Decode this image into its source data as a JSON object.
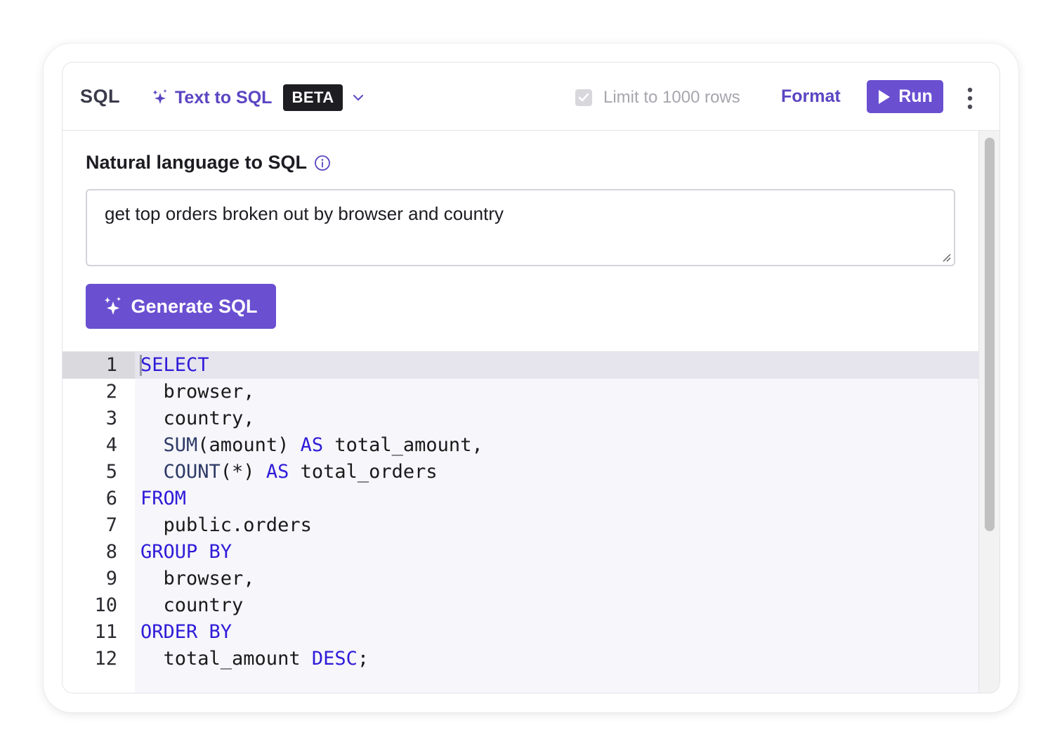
{
  "toolbar": {
    "sql_label": "SQL",
    "text_to_sql_label": "Text to SQL",
    "beta_label": "BETA",
    "limit_label": "Limit to 1000 rows",
    "limit_checked": true,
    "format_label": "Format",
    "run_label": "Run"
  },
  "nl": {
    "label": "Natural language to SQL",
    "query_value": "get top orders broken out by browser and country",
    "generate_label": "Generate SQL"
  },
  "editor": {
    "active_line": 1,
    "lines": [
      {
        "n": "1",
        "tokens": [
          {
            "t": "SELECT",
            "c": "kw"
          }
        ]
      },
      {
        "n": "2",
        "tokens": [
          {
            "t": "  browser,",
            "c": ""
          }
        ]
      },
      {
        "n": "3",
        "tokens": [
          {
            "t": "  country,",
            "c": ""
          }
        ]
      },
      {
        "n": "4",
        "tokens": [
          {
            "t": "  ",
            "c": ""
          },
          {
            "t": "SUM",
            "c": "fn"
          },
          {
            "t": "(amount) ",
            "c": ""
          },
          {
            "t": "AS",
            "c": "kw"
          },
          {
            "t": " total_amount,",
            "c": ""
          }
        ]
      },
      {
        "n": "5",
        "tokens": [
          {
            "t": "  ",
            "c": ""
          },
          {
            "t": "COUNT",
            "c": "fn"
          },
          {
            "t": "(*) ",
            "c": ""
          },
          {
            "t": "AS",
            "c": "kw"
          },
          {
            "t": " total_orders",
            "c": ""
          }
        ]
      },
      {
        "n": "6",
        "tokens": [
          {
            "t": "FROM",
            "c": "kw"
          }
        ]
      },
      {
        "n": "7",
        "tokens": [
          {
            "t": "  public.orders",
            "c": ""
          }
        ]
      },
      {
        "n": "8",
        "tokens": [
          {
            "t": "GROUP BY",
            "c": "kw"
          }
        ]
      },
      {
        "n": "9",
        "tokens": [
          {
            "t": "  browser,",
            "c": ""
          }
        ]
      },
      {
        "n": "10",
        "tokens": [
          {
            "t": "  country",
            "c": ""
          }
        ]
      },
      {
        "n": "11",
        "tokens": [
          {
            "t": "ORDER BY",
            "c": "kw"
          }
        ]
      },
      {
        "n": "12",
        "tokens": [
          {
            "t": "  total_amount ",
            "c": ""
          },
          {
            "t": "DESC",
            "c": "kw"
          },
          {
            "t": ";",
            "c": ""
          }
        ]
      }
    ]
  },
  "icons": {
    "sparkle": "sparkle-icon",
    "chevron": "chevron-down-icon",
    "check": "check-icon",
    "play": "play-icon",
    "more": "more-vertical-icon",
    "info": "info-icon"
  },
  "colors": {
    "accent": "#6a4fd1",
    "accent_text": "#5b45c2",
    "keyword": "#2f1bd8",
    "function": "#2e3a66"
  }
}
